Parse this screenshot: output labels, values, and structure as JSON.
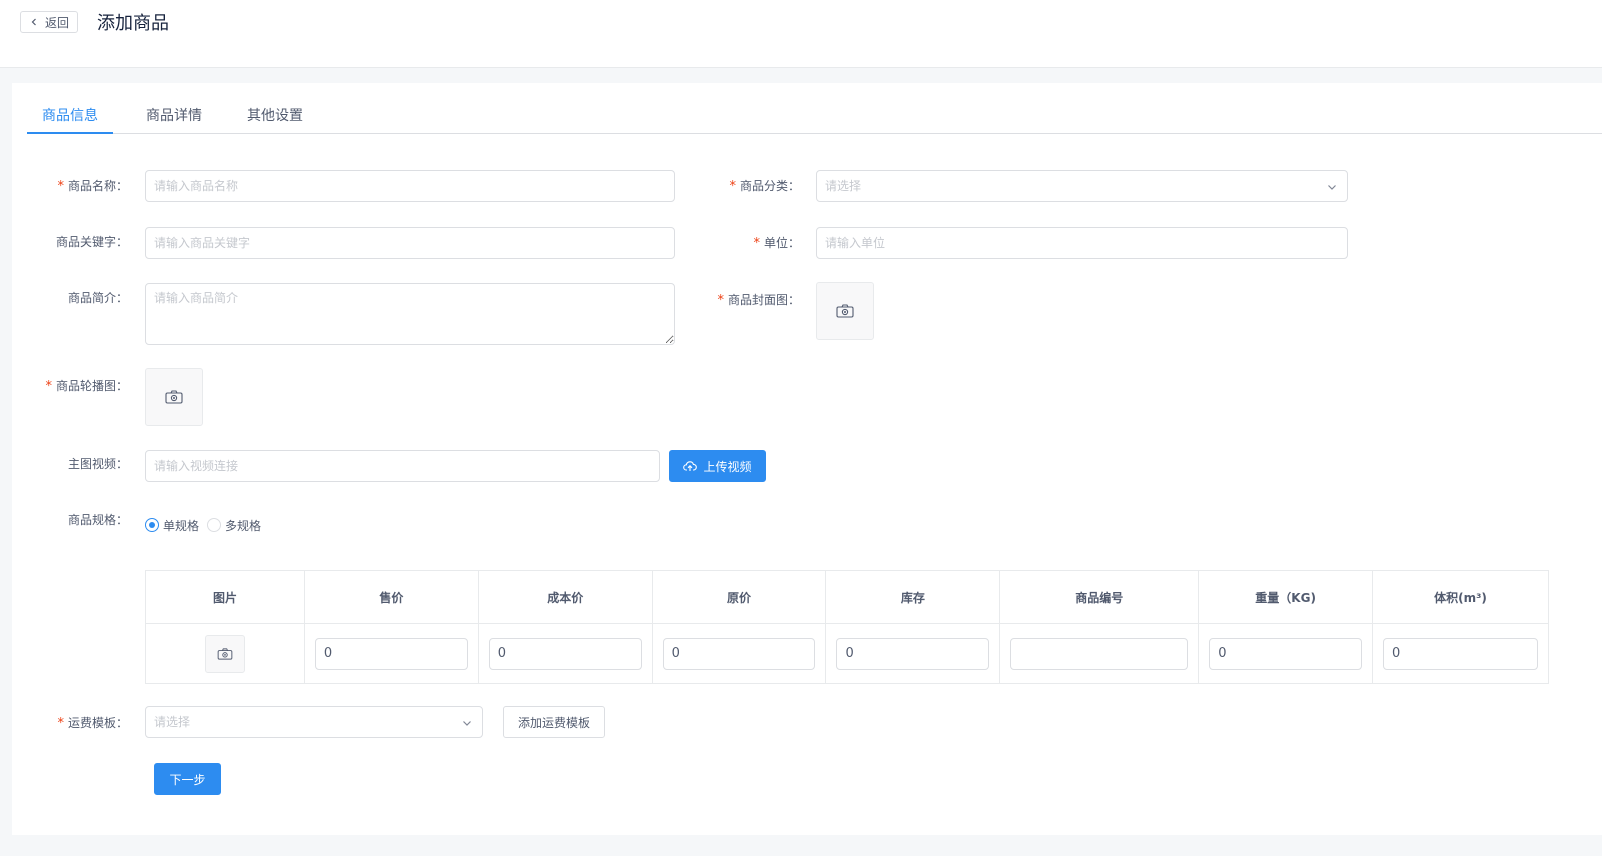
{
  "header": {
    "back_label": "返回",
    "title": "添加商品"
  },
  "tabs": [
    {
      "label": "商品信息",
      "active": true
    },
    {
      "label": "商品详情",
      "active": false
    },
    {
      "label": "其他设置",
      "active": false
    }
  ],
  "form": {
    "name": {
      "label": "商品名称：",
      "placeholder": "请输入商品名称",
      "required": true
    },
    "category": {
      "label": "商品分类：",
      "placeholder": "请选择",
      "required": true
    },
    "keywords": {
      "label": "商品关键字：",
      "placeholder": "请输入商品关键字",
      "required": false
    },
    "unit": {
      "label": "单位：",
      "placeholder": "请输入单位",
      "required": true
    },
    "intro": {
      "label": "商品简介：",
      "placeholder": "请输入商品简介",
      "required": false
    },
    "cover": {
      "label": "商品封面图：",
      "required": true
    },
    "carousel": {
      "label": "商品轮播图：",
      "required": true
    },
    "video": {
      "label": "主图视频：",
      "placeholder": "请输入视频连接",
      "upload_label": "上传视频"
    },
    "spec": {
      "label": "商品规格：",
      "options": [
        "单规格",
        "多规格"
      ],
      "selected": "单规格"
    },
    "shipping": {
      "label": "运费模板：",
      "placeholder": "请选择",
      "add_label": "添加运费模板",
      "required": true
    },
    "next_label": "下一步"
  },
  "sku_table": {
    "headers": [
      "图片",
      "售价",
      "成本价",
      "原价",
      "库存",
      "商品编号",
      "重量（KG)",
      "体积(m³)"
    ],
    "row": {
      "price": "0",
      "cost": "0",
      "original_price": "0",
      "stock": "0",
      "code": "",
      "weight": "0",
      "volume": "0"
    }
  },
  "colors": {
    "primary": "#2d8cf0",
    "required": "#ed4014"
  }
}
